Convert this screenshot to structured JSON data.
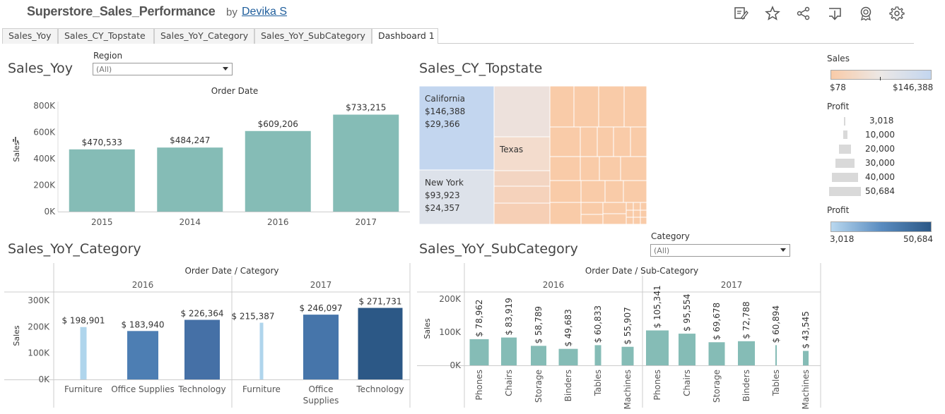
{
  "header": {
    "title": "Superstore_Sales_Performance",
    "by": "by",
    "author": "Devika S"
  },
  "tabs": [
    {
      "label": "Sales_Yoy"
    },
    {
      "label": "Sales_CY_Topstate"
    },
    {
      "label": "Sales_YoY_Category"
    },
    {
      "label": "Sales_YoY_SubCategory"
    },
    {
      "label": "Dashboard 1"
    }
  ],
  "active_tab": "Dashboard 1",
  "icons": [
    "edit-icon",
    "star-icon",
    "share-icon",
    "download-icon",
    "badge-icon",
    "gear-icon"
  ],
  "colors": {
    "teal": "#85bcb6",
    "blue_light": "#afd5ec",
    "blue_mid": "#4d7eb3",
    "blue_dark": "#2c5886",
    "ca_fill": "#c3d6ef",
    "ny_fill": "#dde2ea",
    "orange": "#f9cba8"
  },
  "sales_yoy": {
    "title": "Sales_Yoy",
    "region_label": "Region",
    "region_value": "(All)",
    "chart_data": {
      "type": "bar",
      "title": "Order Date",
      "ylabel": "Sales",
      "categories": [
        "2015",
        "2014",
        "2016",
        "2017"
      ],
      "values": [
        470533,
        484247,
        609206,
        733215
      ],
      "value_labels": [
        "$470,533",
        "$484,247",
        "$609,206",
        "$733,215"
      ],
      "yticks": [
        "800K",
        "600K",
        "400K",
        "200K",
        "0K"
      ],
      "ylim": [
        0,
        800000
      ]
    }
  },
  "sales_cy_topstate": {
    "title": "Sales_CY_Topstate",
    "chart_data": {
      "type": "treemap",
      "items": [
        {
          "state": "California",
          "sales": "$146,388",
          "profit": "$29,366"
        },
        {
          "state": "New York",
          "sales": "$93,923",
          "profit": "$24,357"
        },
        {
          "state": "Texas",
          "sales": "",
          "profit": ""
        }
      ]
    }
  },
  "legends": {
    "sales_title": "Sales",
    "sales_min": "$78",
    "sales_max": "$146,388",
    "profit_size_title": "Profit",
    "profit_sizes": [
      "3,018",
      "10,000",
      "20,000",
      "30,000",
      "40,000",
      "50,684"
    ],
    "profit_color_title": "Profit",
    "profit_min": "3,018",
    "profit_max": "50,684"
  },
  "sales_yoy_category": {
    "title": "Sales_YoY_Category",
    "chart_data": {
      "type": "bar",
      "title": "Order Date / Category",
      "ylabel": "Sales",
      "yticks": [
        "300K",
        "200K",
        "100K",
        "0K"
      ],
      "ylim": [
        0,
        300000
      ],
      "panels": [
        {
          "year": "2016",
          "categories": [
            "Furniture",
            "Office Supplies",
            "Technology"
          ],
          "values": [
            198901,
            183940,
            226364
          ],
          "labels": [
            "$ 198,901",
            "$ 183,940",
            "$ 226,364"
          ]
        },
        {
          "year": "2017",
          "categories": [
            "Furniture",
            "Office Supplies",
            "Technology"
          ],
          "values": [
            215387,
            246097,
            271731
          ],
          "labels": [
            "$ 215,387",
            "$ 246,097",
            "$ 271,731"
          ]
        }
      ]
    }
  },
  "sales_yoy_subcategory": {
    "title": "Sales_YoY_SubCategory",
    "category_label": "Category",
    "category_value": "(All)",
    "chart_data": {
      "type": "bar",
      "title": "Order Date / Sub-Category",
      "ylabel": "Sales",
      "yticks": [
        "200K",
        "100K",
        "0K"
      ],
      "ylim": [
        0,
        200000
      ],
      "panels": [
        {
          "year": "2016",
          "categories": [
            "Phones",
            "Chairs",
            "Storage",
            "Binders",
            "Tables",
            "Machines"
          ],
          "values": [
            78962,
            83919,
            58789,
            49683,
            60833,
            55907
          ],
          "labels": [
            "$ 78,962",
            "$ 83,919",
            "$ 58,789",
            "$ 49,683",
            "$ 60,833",
            "$ 55,907"
          ]
        },
        {
          "year": "2017",
          "categories": [
            "Phones",
            "Chairs",
            "Storage",
            "Binders",
            "Tables",
            "Machines"
          ],
          "values": [
            105341,
            95554,
            69678,
            72788,
            60894,
            43545
          ],
          "labels": [
            "$ 105,341",
            "$ 95,554",
            "$ 69,678",
            "$ 72,788",
            "$ 60,894",
            "$ 43,545"
          ]
        }
      ]
    }
  }
}
